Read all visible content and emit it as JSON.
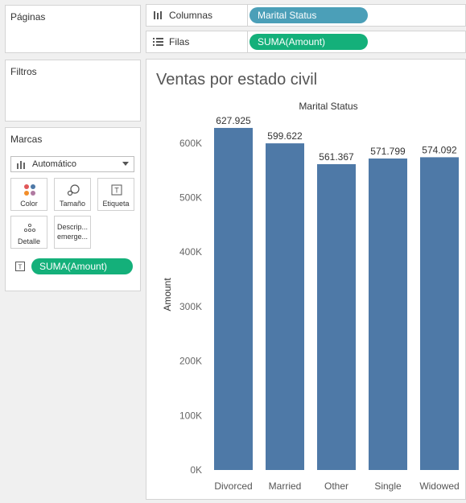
{
  "pages": {
    "title": "Páginas"
  },
  "filters": {
    "title": "Filtros"
  },
  "marks": {
    "title": "Marcas",
    "type_selected": "Automático",
    "buttons": {
      "color": "Color",
      "size": "Tamaño",
      "label": "Etiqueta",
      "detail": "Detalle",
      "tooltip_line1": "Descrip...",
      "tooltip_line2": "emerge..."
    },
    "field_pill": "SUMA(Amount)"
  },
  "shelves": {
    "columns": {
      "label": "Columnas",
      "pill": "Marital Status"
    },
    "rows": {
      "label": "Filas",
      "pill": "SUMA(Amount)"
    }
  },
  "colors": {
    "bar": "#4e79a7",
    "columns_pill": "#4b9fb8",
    "measure_pill": "#14b07a"
  },
  "chart_data": {
    "type": "bar",
    "title": "Ventas por estado civil",
    "header": "Marital Status",
    "ylabel": "Amount",
    "categories": [
      "Divorced",
      "Married",
      "Other",
      "Single",
      "Widowed"
    ],
    "values": [
      627925,
      599622,
      561367,
      571799,
      574092
    ],
    "value_labels": [
      "627.925",
      "599.622",
      "561.367",
      "571.799",
      "574.092"
    ],
    "ylim": [
      0,
      650000
    ],
    "yticks": [
      0,
      100000,
      200000,
      300000,
      400000,
      500000,
      600000
    ],
    "ytick_labels": [
      "0K",
      "100K",
      "200K",
      "300K",
      "400K",
      "500K",
      "600K"
    ]
  }
}
